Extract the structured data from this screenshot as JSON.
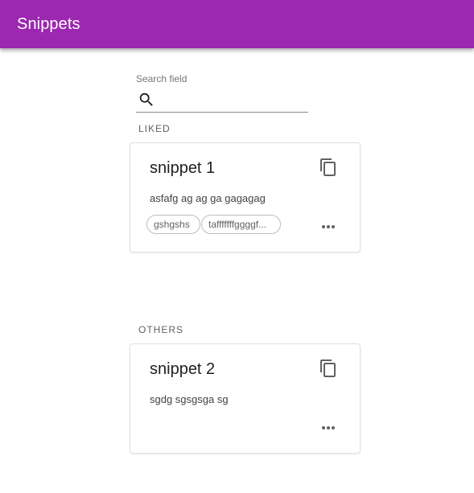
{
  "app": {
    "title": "Snippets",
    "accent": "#9c27b0"
  },
  "search": {
    "label": "Search field",
    "value": "",
    "icon": "search-icon"
  },
  "sections": {
    "liked": "LIKED",
    "others": "OTHERS"
  },
  "snippets": [
    {
      "title": "snippet 1",
      "text": "asfafg ag ag ga gagagag",
      "tags": [
        "gshgshs",
        "tafffffffggggf..."
      ]
    },
    {
      "title": "snippet 2",
      "text": "sgdg sgsgsga sg",
      "tags": []
    }
  ]
}
